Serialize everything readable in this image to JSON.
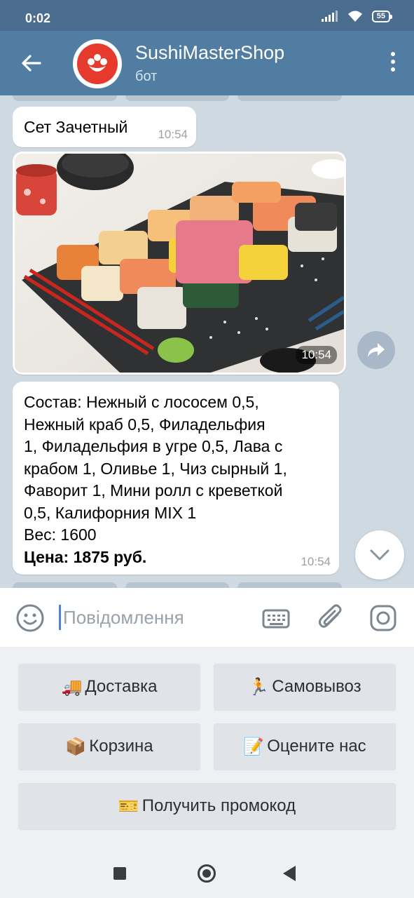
{
  "status_bar": {
    "time": "0:02",
    "battery": "55",
    "icons": [
      "signal-icon",
      "wifi-icon",
      "battery-icon"
    ]
  },
  "header": {
    "title": "SushiMasterShop",
    "subtitle": "бот",
    "back_icon": "arrow-left-icon",
    "menu_icon": "more-vertical-icon"
  },
  "messages": [
    {
      "type": "text",
      "text": "Сет Зачетный",
      "time": "10:54"
    },
    {
      "type": "photo",
      "alt": "sushi set photo",
      "time": "10:54"
    },
    {
      "type": "text",
      "lines": [
        "Состав: Нежный с лососем 0,5,",
        "Нежный краб 0,5, Филадельфия",
        "1, Филадельфия в угре 0,5, Лава с",
        "крабом 1, Оливье 1, Чиз сырный 1,",
        "Фаворит 1, Мини ролл с креветкой",
        "0,5, Калифорния MIX 1",
        "Вес: 1600"
      ],
      "price": "Цена: 1875 руб.",
      "time": "10:54"
    }
  ],
  "input": {
    "placeholder": "Повідомлення",
    "value": ""
  },
  "keyboard": {
    "buttons": [
      {
        "emoji": "🚚",
        "label": "Доставка"
      },
      {
        "emoji": "🏃",
        "label": "Самовывоз"
      },
      {
        "emoji": "📦",
        "label": "Корзина"
      },
      {
        "emoji": "📝",
        "label": "Оцените нас"
      },
      {
        "emoji": "🎫",
        "label": "Получить промокод"
      }
    ]
  },
  "colors": {
    "header": "#527da3",
    "status_bar": "#4a6d8f",
    "chat_bg": "#cfd9e2",
    "bubble": "#ffffff",
    "time_text": "#9aa2a9",
    "keyboard_bg": "#eef0f3",
    "key_bg": "#e0e4e8",
    "accent": "#4a88c8",
    "logo_red": "#e63a2c"
  }
}
